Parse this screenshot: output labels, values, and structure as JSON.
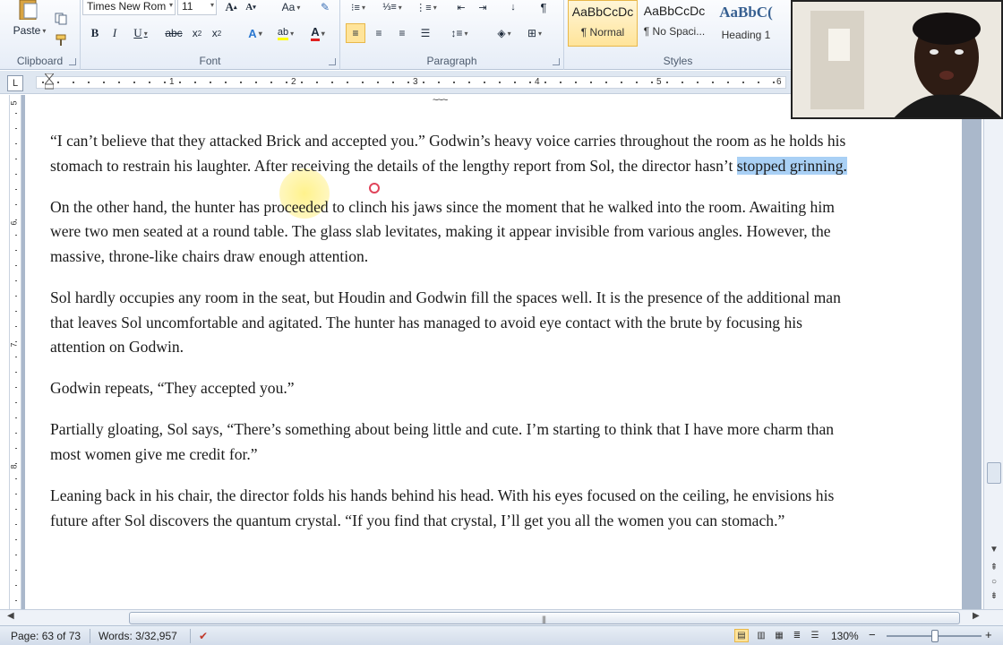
{
  "ribbon": {
    "clipboard": {
      "label": "Clipboard",
      "paste_label": "Paste"
    },
    "font": {
      "label": "Font",
      "font_name": "Times New Rom",
      "font_size": "11"
    },
    "paragraph": {
      "label": "Paragraph"
    },
    "styles": {
      "label": "Styles",
      "tiles": [
        {
          "sample": "AaBbCcDc",
          "name": "¶ Normal"
        },
        {
          "sample": "AaBbCcDc",
          "name": "¶ No Spaci..."
        },
        {
          "sample": "AaBbC(",
          "name": "Heading 1"
        }
      ]
    }
  },
  "ruler": {
    "numbers": [
      "1",
      "2",
      "3",
      "4",
      "5",
      "6"
    ],
    "tab_glyph": "L"
  },
  "vruler": {
    "numbers": [
      "5",
      "6",
      "7",
      "8"
    ]
  },
  "document": {
    "pagebreak_glyph": "~~~",
    "paragraphs": [
      {
        "before": "“I can’t believe that they attacked Brick and accepted you.” Godwin’s heavy voice carries throughout the room as he holds his stomach to restrain his laughter. After receiving the details of the lengthy report from Sol, the director hasn’t ",
        "selected": "stopped grinning.",
        "after": ""
      },
      {
        "before": "On the other hand, the hunter has proceeded to clinch his jaws since the moment that he walked into the room. Awaiting him were two men seated at a round table. The glass slab levitates, making it appear invisible from various angles. However, the massive, throne-like chairs draw enough attention.",
        "selected": "",
        "after": ""
      },
      {
        "before": "Sol hardly occupies any room in the seat, but Houdin and Godwin fill the spaces well. It is the presence of the additional man that leaves Sol uncomfortable and agitated. The hunter has managed to avoid eye contact with the brute by focusing his attention on Godwin.",
        "selected": "",
        "after": ""
      },
      {
        "before": "Godwin repeats, “They accepted you.”",
        "selected": "",
        "after": ""
      },
      {
        "before": "Partially gloating, Sol says, “There’s something about being little and cute. I’m starting to think that I have more charm than most women give me credit for.”",
        "selected": "",
        "after": ""
      },
      {
        "before": "Leaning back in his chair, the director folds his hands behind his head. With his eyes focused on the ceiling,  he envisions his future after Sol discovers the quantum crystal. “If you find that crystal, I’ll get you all the women you can stomach.”",
        "selected": "",
        "after": ""
      }
    ]
  },
  "status": {
    "page": "Page: 63 of 73",
    "words": "Words: 3/32,957",
    "zoom": "130%",
    "zoom_minus": "−",
    "zoom_plus": "+"
  },
  "colors": {
    "selection": "#a9d0f5",
    "ribbon_accent": "#ffe49a"
  }
}
